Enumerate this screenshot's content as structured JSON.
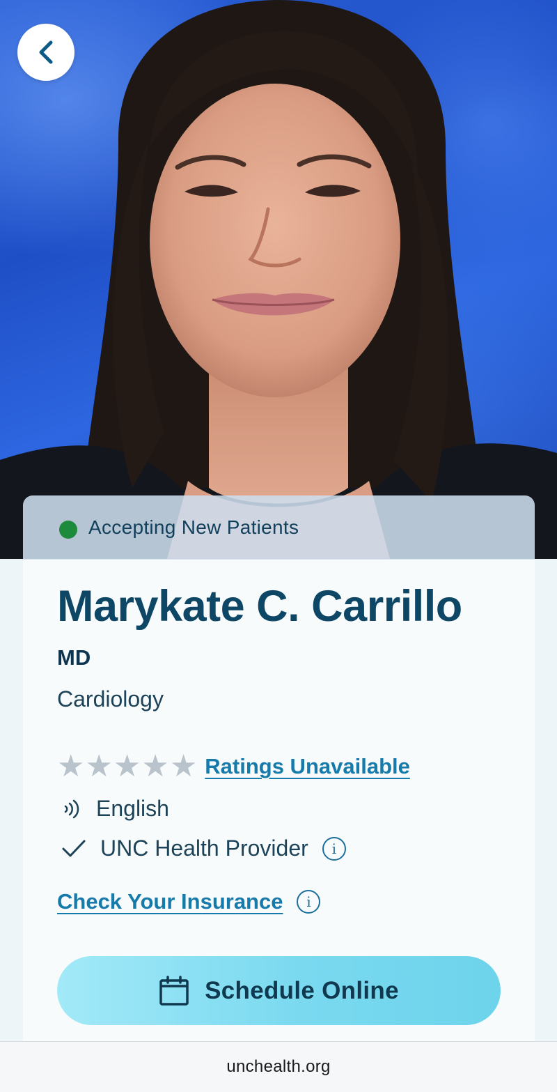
{
  "hero": {
    "back_icon": "chevron-left-icon"
  },
  "status": {
    "label": "Accepting New Patients",
    "dot_color": "#1e8a3c"
  },
  "provider": {
    "name": "Marykate C. Carrillo",
    "credential": "MD",
    "specialty": "Cardiology"
  },
  "ratings": {
    "stars_filled": 0,
    "stars_total": 5,
    "label": "Ratings Unavailable"
  },
  "details": {
    "language": "English",
    "language_icon": "speech-waves-icon",
    "affiliation": "UNC Health Provider",
    "affiliation_icon": "checkmark-icon",
    "info_glyph": "i"
  },
  "insurance": {
    "label": "Check Your Insurance"
  },
  "actions": {
    "schedule_label": "Schedule Online",
    "schedule_icon": "calendar-icon"
  },
  "browser": {
    "url": "unchealth.org"
  },
  "colors": {
    "brand_dark": "#0e4766",
    "link": "#167aab",
    "button": "#7ad9ef"
  }
}
